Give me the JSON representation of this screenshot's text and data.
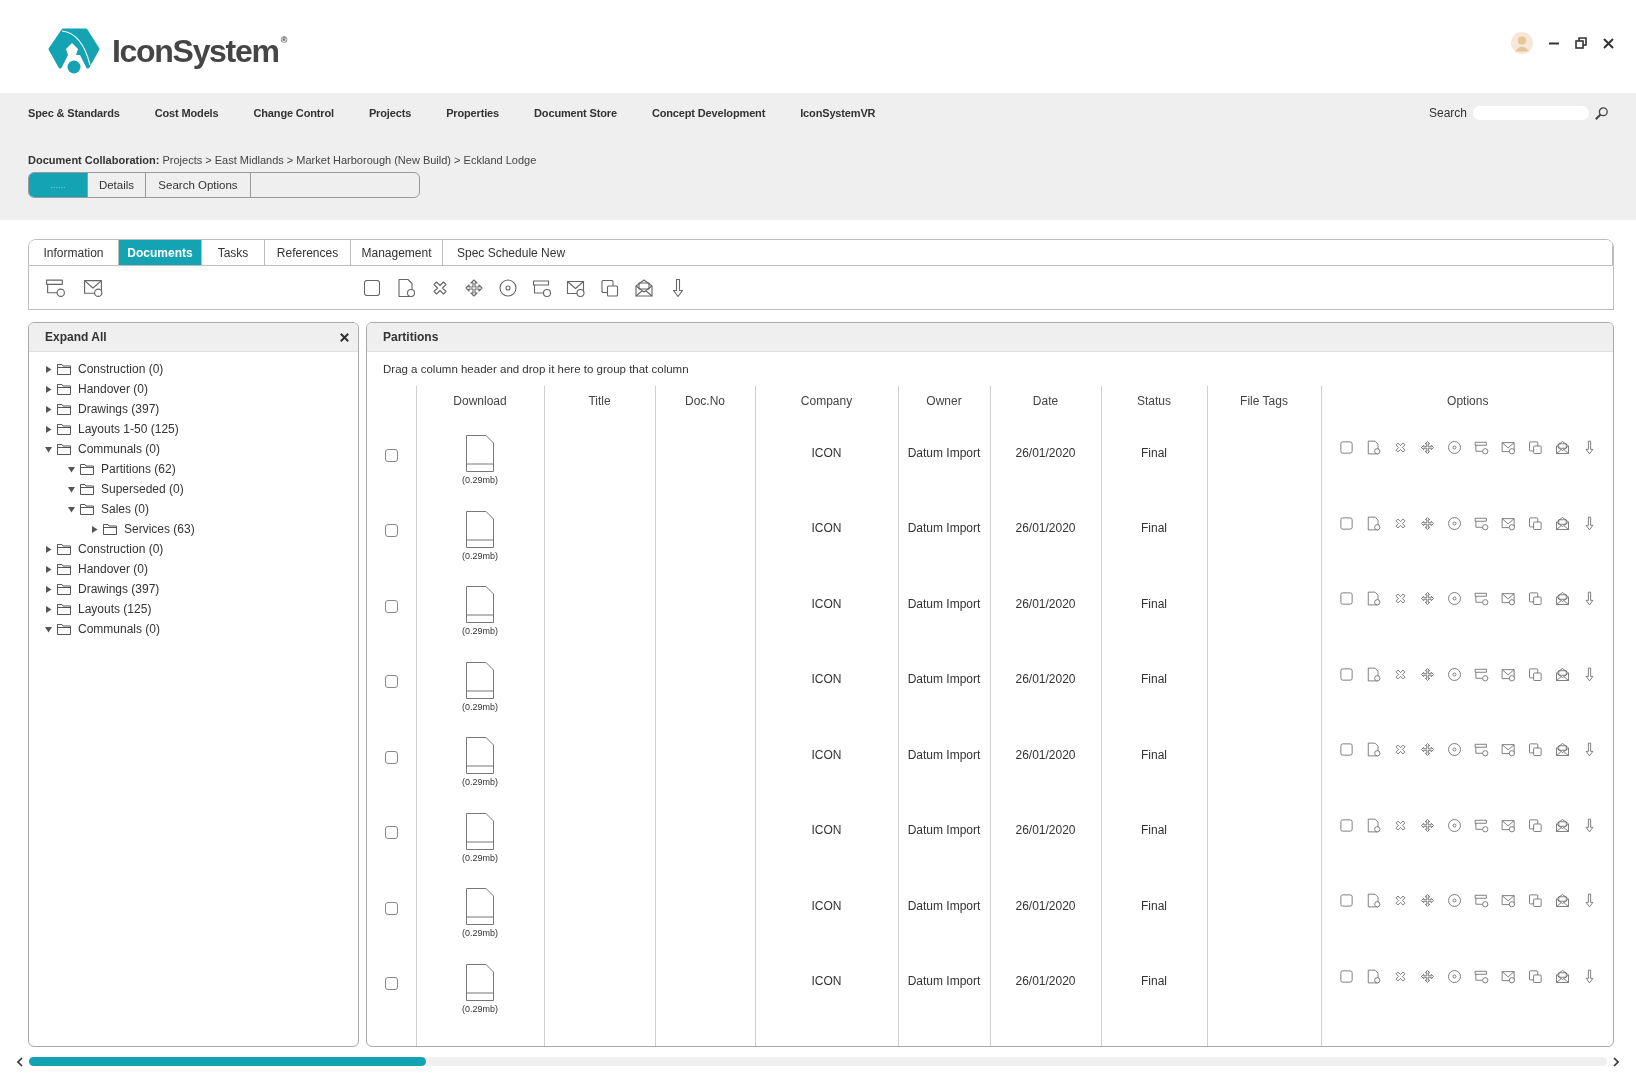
{
  "header": {
    "logo": "IconSystem$^{®}$"
  },
  "nav": {
    "items": [
      "Spec & Standards",
      "Cost Models",
      "Change Control",
      "Projects",
      "Properties",
      "Document Store",
      "Concept Development",
      "IconSystemVR"
    ],
    "search": {
      "label": "Search"
    }
  },
  "breadcrumb": "**Document Collaboration:** Projects > East Midlands > Market Harborough (New Build) > Eckland Lodge",
  "subnav": [
    {
      "label": "......",
      "selected": true
    },
    {
      "label": "Details",
      "selected": false
    },
    {
      "label": "Search Options",
      "selected": false
    }
  ],
  "tabs": [
    {
      "label": "Information",
      "selected": false
    },
    {
      "label": "Documents",
      "selected": true
    },
    {
      "label": "Tasks",
      "selected": false
    },
    {
      "label": "References",
      "selected": false
    },
    {
      "label": "Management",
      "selected": false
    },
    {
      "label": "Spec Schedule New",
      "selected": false
    }
  ],
  "tree_panel": {
    "title": "Expand All",
    "items": [
      {
        "label": "Construction (0)",
        "expanded": false
      },
      {
        "label": "Handover (0)",
        "expanded": false
      },
      {
        "label": "Drawings (397)",
        "expanded": false
      },
      {
        "label": "Layouts 1-50 (125)",
        "expanded": false
      },
      {
        "label": "Communals (0)",
        "expanded": true,
        "children": [
          {
            "label": "Partitions (62)",
            "expanded": true
          },
          {
            "label": "Superseded (0)",
            "expanded": true
          },
          {
            "label": "Sales (0)",
            "expanded": true,
            "children": [
              {
                "label": "Services (63)",
                "expanded": false
              }
            ]
          }
        ]
      },
      {
        "label": "Construction (0)",
        "expanded": false
      },
      {
        "label": "Handover (0)",
        "expanded": false
      },
      {
        "label": "Drawings (397)",
        "expanded": false
      },
      {
        "label": "Layouts (125)",
        "expanded": false
      },
      {
        "label": "Communals (0)",
        "expanded": true
      }
    ]
  },
  "documents_panel": {
    "title": "Partitions",
    "group_hint": "Drag a column header and drop it here to group that column",
    "columns": [
      "Download",
      "Title",
      "Doc.No",
      "Company",
      "Owner",
      "Date",
      "Status",
      "File Tags",
      "Options"
    ],
    "rows": [
      {
        "checked": false,
        "size": "(0.29mb)",
        "company": "ICON",
        "owner": "Datum Import",
        "date": "26/01/2020",
        "status": "Final"
      },
      {
        "checked": false,
        "size": "(0.29mb)",
        "company": "ICON",
        "owner": "Datum Import",
        "date": "26/01/2020",
        "status": "Final"
      },
      {
        "checked": false,
        "size": "(0.29mb)",
        "company": "ICON",
        "owner": "Datum Import",
        "date": "26/01/2020",
        "status": "Final"
      },
      {
        "checked": false,
        "size": "(0.29mb)",
        "company": "ICON",
        "owner": "Datum Import",
        "date": "26/01/2020",
        "status": "Final"
      },
      {
        "checked": false,
        "size": "(0.29mb)",
        "company": "ICON",
        "owner": "Datum Import",
        "date": "26/01/2020",
        "status": "Final"
      },
      {
        "checked": false,
        "size": "(0.29mb)",
        "company": "ICON",
        "owner": "Datum Import",
        "date": "26/01/2020",
        "status": "Final"
      },
      {
        "checked": false,
        "size": "(0.29mb)",
        "company": "ICON",
        "owner": "Datum Import",
        "date": "26/01/2020",
        "status": "Final"
      },
      {
        "checked": false,
        "size": "(0.29mb)",
        "company": "ICON",
        "owner": "Datum Import",
        "date": "26/01/2020",
        "status": "Final"
      }
    ]
  }
}
